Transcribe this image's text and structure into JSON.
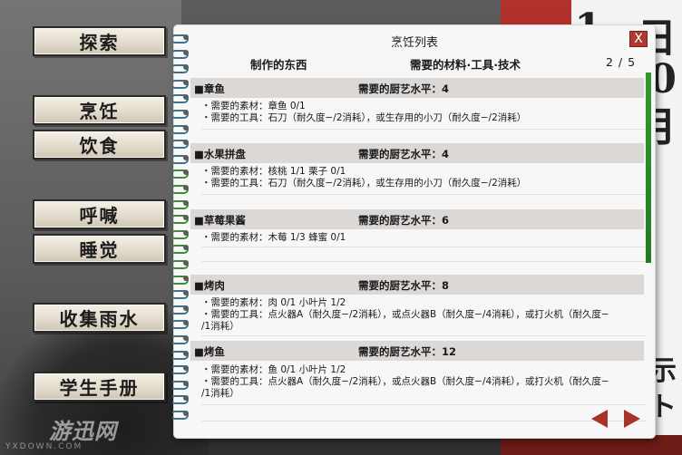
{
  "menu": [
    {
      "label": "探索"
    },
    {
      "label": "烹饪"
    },
    {
      "label": "饮食"
    },
    {
      "label": "呼喊"
    },
    {
      "label": "睡觉"
    },
    {
      "label": "收集雨水"
    },
    {
      "label": "学生手册"
    }
  ],
  "panel": {
    "title": "烹饪列表",
    "close_label": "X",
    "col_item": "制作的东西",
    "col_req": "需要的材料·工具·技术",
    "page": "2 / 5"
  },
  "recipes": [
    {
      "name": "■章鱼",
      "level": "需要的厨艺水平：4",
      "lines": [
        "・需要的素材：章鱼 0/1",
        "・需要的工具：石刀（耐久度−/2消耗），或生存用的小刀（耐久度−/2消耗）"
      ]
    },
    {
      "name": "■水果拼盘",
      "level": "需要的厨艺水平：4",
      "lines": [
        "・需要的素材：核桃 1/1 栗子 0/1",
        "・需要的工具：石刀（耐久度−/2消耗），或生存用的小刀（耐久度−/2消耗）"
      ]
    },
    {
      "name": "■草莓果酱",
      "level": "需要的厨艺水平：6",
      "lines": [
        "・需要的素材：木莓 1/3 蜂蜜 0/1"
      ]
    },
    {
      "name": "■烤肉",
      "level": "需要的厨艺水平：8",
      "lines": [
        "・需要的素材：肉 0/1 小叶片 1/2",
        "・需要的工具：点火器A（耐久度−/2消耗），或点火器B（耐久度−/4消耗），或打火机（耐久度−",
        "/1消耗）"
      ]
    },
    {
      "name": "■烤鱼",
      "level": "需要的厨艺水平：12",
      "lines": [
        "・需要的素材：鱼 0/1 小叶片 1/2",
        "・需要的工具：点火器A（耐久度−/2消耗），或点火器B（耐久度−/4消耗），或打火机（耐久度−",
        "/1消耗）"
      ]
    }
  ],
  "calendar_chars": [
    "1",
    "日",
    "0",
    "月",
    "示",
    "ト"
  ],
  "watermark": {
    "main": "游迅网",
    "sub": "YXDOWN.COM"
  },
  "colors": {
    "accent_red": "#a8332b",
    "row_bg": "#dcd8d6",
    "binding_green": "#2f9a2f"
  },
  "icons": {
    "prev": "triangle-left",
    "next": "triangle-right",
    "close": "x"
  }
}
